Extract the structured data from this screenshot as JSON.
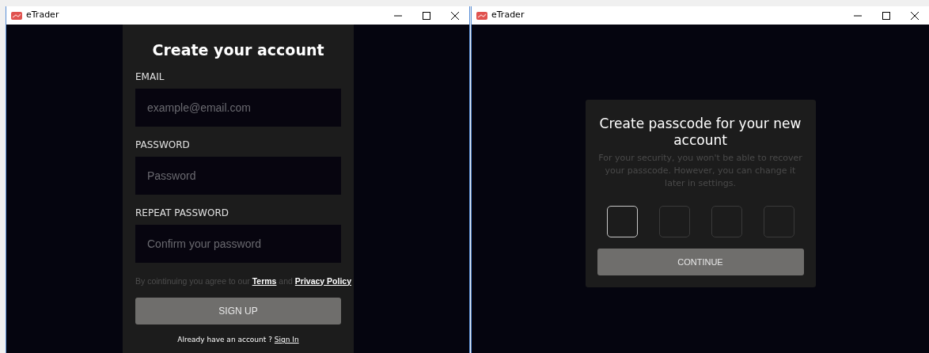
{
  "windows": [
    {
      "title": "eTrader",
      "kind": "signup",
      "heading": "Create your account",
      "fields": [
        {
          "label": "EMAIL",
          "placeholder": "example@email.com"
        },
        {
          "label": "PASSWORD",
          "placeholder": "Password"
        },
        {
          "label": "REPEAT PASSWORD",
          "placeholder": "Confirm your password"
        }
      ],
      "agreement": {
        "text": "By cointinuing you agree to our",
        "terms": "Terms",
        "and": "and",
        "privacy": "Privacy Policy"
      },
      "button": "SIGN UP",
      "signin": {
        "text": "Already have an account ?",
        "link": "Sign In"
      }
    },
    {
      "title": "eTrader",
      "kind": "passcode",
      "heading": "Create passcode for your new account",
      "description": "For your security, you won't be able to recover your passcode. However, you can change it later in settings.",
      "digits": [
        {
          "selected": true
        },
        {
          "selected": false
        },
        {
          "selected": false
        },
        {
          "selected": false
        }
      ],
      "button": "CONTINUE"
    }
  ]
}
